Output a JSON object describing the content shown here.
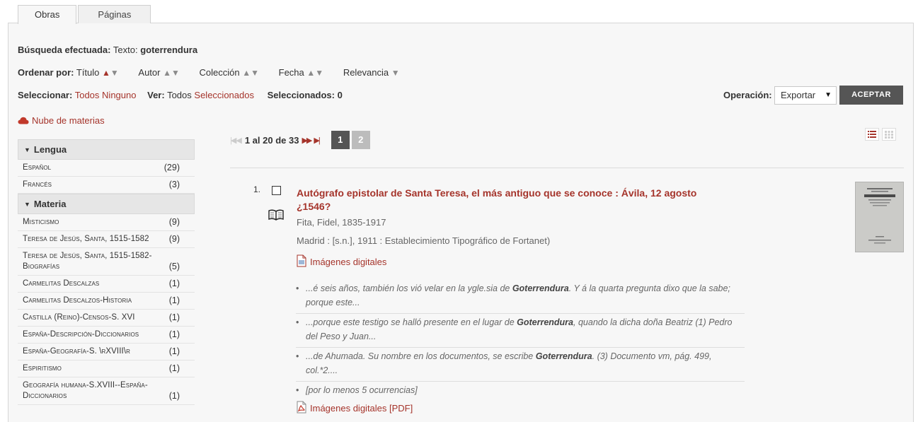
{
  "tabs": [
    "Obras",
    "Páginas"
  ],
  "search": {
    "label": "Búsqueda efectuada:",
    "text_label": "Texto:",
    "term": "goterrendura"
  },
  "sort": {
    "label": "Ordenar por:",
    "options": [
      "Título",
      "Autor",
      "Colección",
      "Fecha",
      "Relevancia"
    ]
  },
  "selection": {
    "select_label": "Seleccionar:",
    "all": "Todos",
    "none": "Ninguno",
    "view_label": "Ver:",
    "view_all": "Todos",
    "view_selected": "Seleccionados",
    "selected_count_label": "Seleccionados: 0"
  },
  "operation": {
    "label": "Operación:",
    "selected": "Exportar",
    "accept": "ACEPTAR"
  },
  "cloud_link": "Nube de materias",
  "facets": [
    {
      "title": "Lengua",
      "items": [
        {
          "label": "Español",
          "count": "(29)"
        },
        {
          "label": "Francés",
          "count": "(3)"
        }
      ]
    },
    {
      "title": "Materia",
      "items": [
        {
          "label": "Misticismo",
          "count": "(9)"
        },
        {
          "label": "Teresa de Jesús, Santa, 1515-1582",
          "count": "(9)"
        },
        {
          "label": "Teresa de Jesús, Santa, 1515-1582-Biografías",
          "count": "(5)"
        },
        {
          "label": "Carmelitas Descalzas",
          "count": "(1)"
        },
        {
          "label": "Carmelitas Descalzos-Historia",
          "count": "(1)"
        },
        {
          "label": "Castilla (Reino)-Censos-S. XVI",
          "count": "(1)"
        },
        {
          "label": "España-Descripción-Diccionarios",
          "count": "(1)"
        },
        {
          "label": "España-Geografía-S. \\rXVIII\\r",
          "count": "(1)"
        },
        {
          "label": "Espiritismo",
          "count": "(1)"
        },
        {
          "label": "Geografía humana-S.XVIII--España-Diccionarios",
          "count": "(1)"
        }
      ]
    }
  ],
  "pager": {
    "range": "1 al 20 de 33",
    "pages": [
      "1",
      "2"
    ]
  },
  "result": {
    "number": "1.",
    "title": "Autógrafo epistolar de Santa Teresa, el más antiguo que se conoce : Ávila, 12 agosto ¿1546?",
    "author": "Fita, Fidel, 1835-1917",
    "publication": "Madrid : [s.n.], 1911 : Establecimiento Tipográfico de Fortanet)",
    "digital_images": "Imágenes digitales",
    "snippets": [
      {
        "pre": "...é seis años, también los vió velar en la ygle.sia de ",
        "hl": "Goterrendura",
        "post": ". Y á la quarta pregunta dixo que la sabe; porque este..."
      },
      {
        "pre": "...porque este testigo se halló presente en el lugar de ",
        "hl": "Goterrendura",
        "post": ", quando la dicha doña Beatriz (1) Pedro del Peso y Juan..."
      },
      {
        "pre": "...de Ahumada. Su nombre en los documentos, se escribe ",
        "hl": "Goterrendura",
        "post": ". (3) Documento vm, pág. 499, col.*2...."
      }
    ],
    "occurrences": "[por lo menos 5 ocurrencias]",
    "pdf_link": "Imágenes digitales [PDF]"
  },
  "colors": {
    "accent": "#a5342b",
    "button": "#555555",
    "panel": "#f7f7f7"
  }
}
